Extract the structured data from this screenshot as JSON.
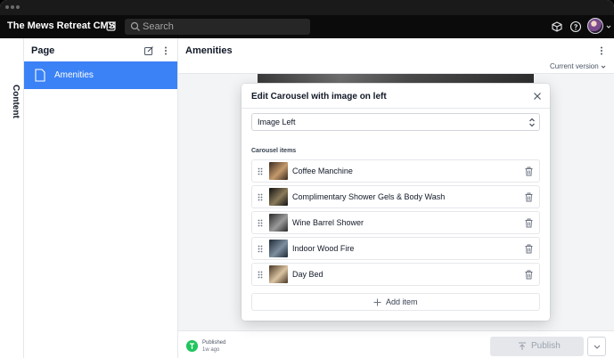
{
  "app": {
    "title": "The Mews Retreat CMS"
  },
  "search": {
    "placeholder": "Search"
  },
  "rail": {
    "label": "Content"
  },
  "panel": {
    "title": "Page",
    "items": [
      {
        "label": "Amenities",
        "icon": "document-icon",
        "selected": true
      }
    ]
  },
  "main": {
    "title": "Amenities",
    "version_label": "Current version"
  },
  "modal": {
    "title": "Edit Carousel with image on left",
    "layout_select": {
      "value": "Image Left"
    },
    "section_label": "Carousel items",
    "items": [
      {
        "label": "Coffee Manchine",
        "thumb_colors": [
          "#3b2a1e",
          "#c49a6c"
        ]
      },
      {
        "label": "Complimentary Shower Gels & Body Wash",
        "thumb_colors": [
          "#111111",
          "#8a7a5a"
        ]
      },
      {
        "label": "Wine Barrel Shower",
        "thumb_colors": [
          "#2a2a2a",
          "#9a9a9a"
        ]
      },
      {
        "label": "Indoor Wood Fire",
        "thumb_colors": [
          "#1f2a36",
          "#7d8e9e"
        ]
      },
      {
        "label": "Day Bed",
        "thumb_colors": [
          "#4a3524",
          "#d9c3a1"
        ]
      }
    ],
    "add_label": "Add item"
  },
  "footer": {
    "status": "Published",
    "time": "1w ago",
    "publish_label": "Publish"
  },
  "colors": {
    "accent": "#3b82f6",
    "topbar": "#0b0b0b",
    "published": "#22c55e"
  }
}
